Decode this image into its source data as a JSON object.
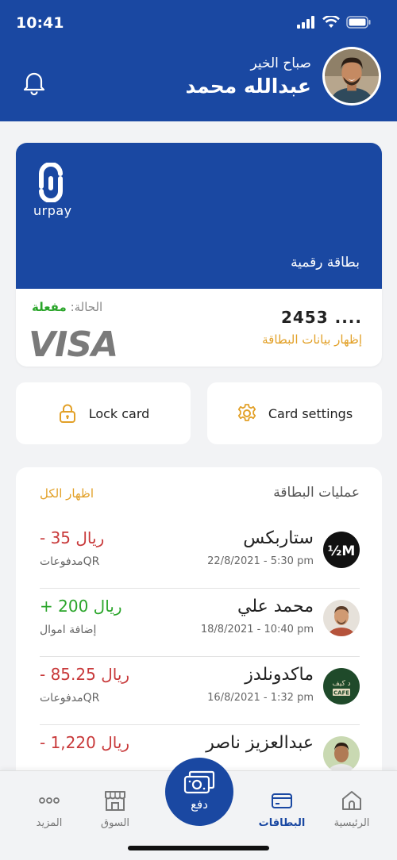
{
  "status_bar": {
    "time": "10:41"
  },
  "header": {
    "greeting": "صباح الخير",
    "user_name": "عبدالله محمد",
    "bg_color": "#1a48a2"
  },
  "card": {
    "brand": "urpay",
    "type_label": "بطاقة رقمية",
    "status_label": "الحالة:",
    "status_value": "مفعلة",
    "number_masked": "2453 ....",
    "show_details": "إظهار بيانات البطاقة",
    "network": "VISA"
  },
  "actions": {
    "lock": "Lock card",
    "settings": "Card settings"
  },
  "transactions": {
    "title": "عمليات البطاقة",
    "show_all": "اظهار الكل",
    "items": [
      {
        "name": "ستاربكس",
        "date": "22/8/2021 - 5:30 pm",
        "amount": "- 35 ريال",
        "method": "مدفوعاتQR",
        "direction": "out",
        "icon": "starbucks-logo"
      },
      {
        "name": "محمد علي",
        "date": "18/8/2021 - 10:40 pm",
        "amount": "+ 200 ريال",
        "method": "إضافة اموال",
        "direction": "in",
        "icon": "person-avatar"
      },
      {
        "name": "ماكدونلدز",
        "date": "16/8/2021 - 1:32 pm",
        "amount": "- 85.25 ريال",
        "method": "مدفوعاتQR",
        "direction": "out",
        "icon": "cafe-logo"
      },
      {
        "name": "عبدالعزيز ناصر",
        "date": "",
        "amount": "- 1,220 ريال",
        "method": "",
        "direction": "out",
        "icon": "person-avatar"
      }
    ]
  },
  "tabbar": {
    "home": "الرئيسية",
    "cards": "البطاقات",
    "pay": "دفع",
    "market": "السوق",
    "more": "المزيد",
    "active": "cards"
  },
  "colors": {
    "primary": "#1a48a2",
    "accent": "#e2a027",
    "positive": "#2aa52a",
    "negative": "#c8393a"
  }
}
